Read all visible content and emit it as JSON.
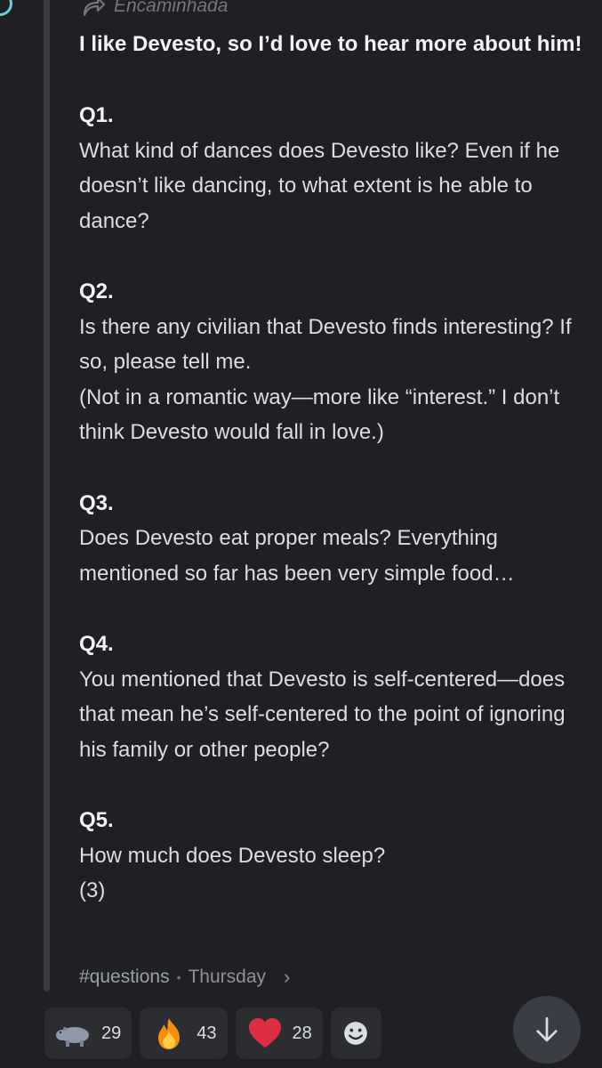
{
  "forward": {
    "label": "Encaminhada"
  },
  "message": {
    "title": "I like Devesto, so I’d love to hear more about him!",
    "questions": [
      {
        "label": "Q1.",
        "text": "What kind of dances does Devesto like? Even if he doesn’t like dancing, to what extent is he able to dance?"
      },
      {
        "label": "Q2.",
        "text": "Is there any civilian that Devesto finds interesting? If so, please tell me.\n(Not in a romantic way—more like “interest.” I don’t think Devesto would fall in love.)"
      },
      {
        "label": "Q3.",
        "text": "Does Devesto eat proper meals? Everything mentioned so far has been very simple food…"
      },
      {
        "label": "Q4.",
        "text": "You mentioned that Devesto is self-centered—does that mean he’s self-centered to the point of ignoring his family or other people?"
      },
      {
        "label": "Q5.",
        "text": "How much does Devesto sleep?\n(3)"
      }
    ]
  },
  "footer": {
    "channel": "#questions",
    "separator": "•",
    "time": "Thursday"
  },
  "reactions": [
    {
      "icon": "hippo-icon",
      "count": "29"
    },
    {
      "icon": "fire-icon",
      "count": "43"
    },
    {
      "icon": "heart-icon",
      "count": "28"
    }
  ],
  "colors": {
    "background": "#1f1f24",
    "reaction_bg": "#2b2d31",
    "accent_avatar": "#5fd3d6"
  }
}
